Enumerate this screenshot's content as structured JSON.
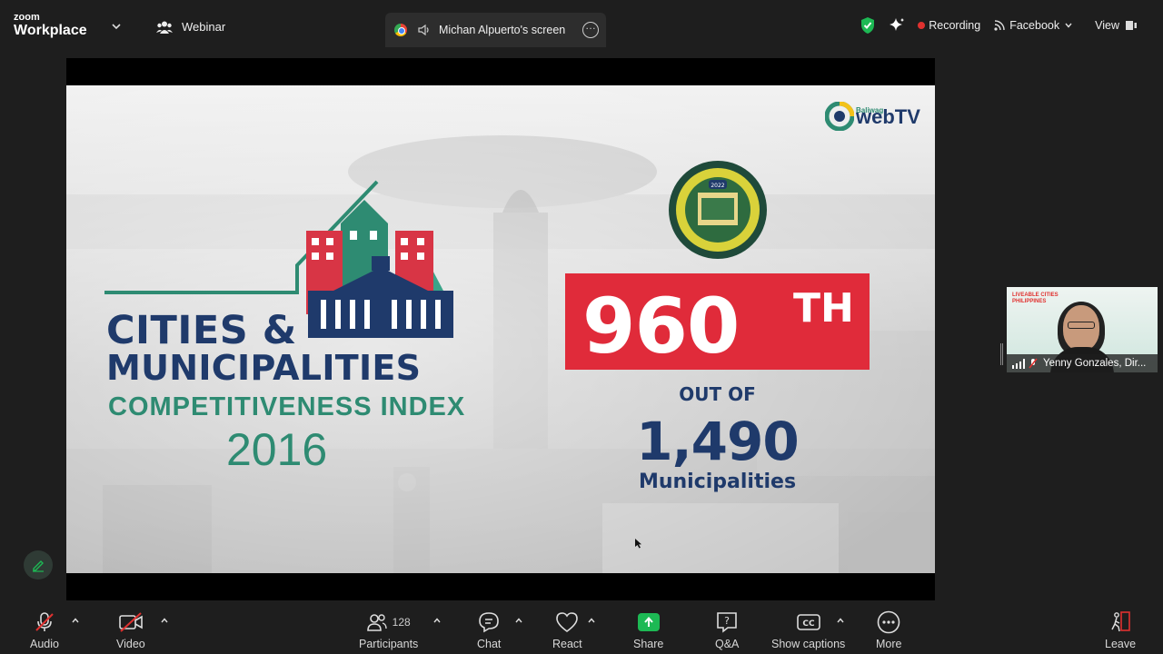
{
  "app": {
    "logo_line1": "zoom",
    "logo_line2": "Workplace"
  },
  "topbar": {
    "webinar_label": "Webinar",
    "share_tab_label": "Michan Alpuerto's screen",
    "recording_label": "Recording",
    "stream_label": "Facebook",
    "view_label": "View"
  },
  "slide": {
    "brand_small": "Baliwag",
    "brand_big": "webTV",
    "title_line1": "CITIES &",
    "title_line2": "MUNICIPALITIES",
    "title_line3": "COMPETITIVENESS INDEX",
    "year": "2016",
    "rank_number": "960",
    "rank_suffix": "TH",
    "out_of": "OUT OF",
    "total": "1,490",
    "total_label": "Municipalities",
    "seal_year": "2022"
  },
  "participant": {
    "name": "Yenny Gonzales, Dir...",
    "org_line1": "LIVEABLE CITIES",
    "org_line2": "PHILIPPINES"
  },
  "toolbar": {
    "audio": "Audio",
    "video": "Video",
    "participants": "Participants",
    "participant_count": "128",
    "chat": "Chat",
    "react": "React",
    "share": "Share",
    "qa": "Q&A",
    "captions": "Show captions",
    "more": "More",
    "leave": "Leave"
  },
  "colors": {
    "accent_green": "#1db954",
    "record_red": "#e0312f",
    "slide_navy": "#1f3a6b",
    "slide_teal": "#2e8b72",
    "slide_red": "#e02b3a"
  }
}
